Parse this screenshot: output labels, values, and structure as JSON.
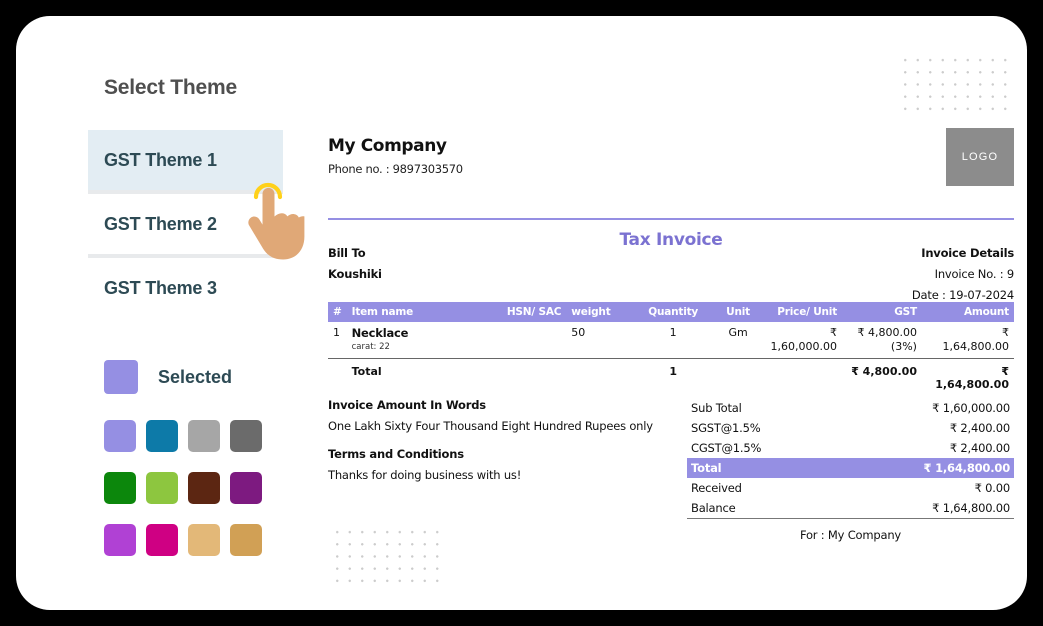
{
  "panel": {
    "title": "Select Theme",
    "themes": [
      {
        "label": "GST Theme 1",
        "active": true
      },
      {
        "label": "GST Theme 2",
        "active": false
      },
      {
        "label": "GST Theme 3",
        "active": false
      }
    ],
    "selected_label": "Selected",
    "selected_color": "#958fe3",
    "palette": [
      {
        "name": "periwinkle",
        "hex": "#958fe3"
      },
      {
        "name": "teal-blue",
        "hex": "#0d7aa8"
      },
      {
        "name": "light-gray",
        "hex": "#a6a6a6"
      },
      {
        "name": "dark-gray",
        "hex": "#6b6b6b"
      },
      {
        "name": "green",
        "hex": "#0c870c"
      },
      {
        "name": "lime-green",
        "hex": "#8dc63f"
      },
      {
        "name": "dark-brown",
        "hex": "#5c2612"
      },
      {
        "name": "purple",
        "hex": "#7d1a80"
      },
      {
        "name": "orchid",
        "hex": "#b041d4"
      },
      {
        "name": "magenta",
        "hex": "#cf0083"
      },
      {
        "name": "light-tan",
        "hex": "#e3b878"
      },
      {
        "name": "tan",
        "hex": "#d1a055"
      }
    ]
  },
  "invoice": {
    "company_name": "My Company",
    "company_phone": "Phone no. : 9897303570",
    "logo_text": "LOGO",
    "title": "Tax Invoice",
    "accent_color": "#958fe3",
    "bill_to": {
      "label": "Bill To",
      "name": "Koushiki"
    },
    "details": {
      "label": "Invoice Details",
      "invoice_no": "Invoice No. : 9",
      "date": "Date : 19-07-2024"
    },
    "table": {
      "headers": [
        "#",
        "Item name",
        "HSN/ SAC",
        "weight",
        "Quantity",
        "Unit",
        "Price/ Unit",
        "GST",
        "Amount"
      ],
      "rows": [
        {
          "sno": "1",
          "item_name": "Necklace",
          "item_sub": "carat: 22",
          "hsn": "",
          "weight": "50",
          "quantity": "1",
          "unit": "Gm",
          "price_line1": "₹",
          "price_line2": "1,60,000.00",
          "gst_line1": "₹ 4,800.00",
          "gst_line2": "(3%)",
          "amount_line1": "₹",
          "amount_line2": "1,64,800.00"
        }
      ],
      "total": {
        "label": "Total",
        "quantity": "1",
        "gst": "₹ 4,800.00",
        "amount_line1": "₹",
        "amount_line2": "1,64,800.00"
      }
    },
    "words": {
      "heading": "Invoice Amount In Words",
      "text": "One Lakh Sixty Four Thousand Eight Hundred Rupees only"
    },
    "terms": {
      "heading": "Terms and Conditions",
      "text": "Thanks for doing business with us!"
    },
    "summary": [
      {
        "label": "Sub Total",
        "amount": "₹ 1,60,000.00",
        "highlight": false
      },
      {
        "label": "SGST@1.5%",
        "amount": "₹ 2,400.00",
        "highlight": false
      },
      {
        "label": "CGST@1.5%",
        "amount": "₹ 2,400.00",
        "highlight": false
      },
      {
        "label": "Total",
        "amount": "₹ 1,64,800.00",
        "highlight": true
      },
      {
        "label": "Received",
        "amount": "₹ 0.00",
        "highlight": false
      },
      {
        "label": "Balance",
        "amount": "₹ 1,64,800.00",
        "highlight": false
      }
    ],
    "signature": "For : My Company"
  },
  "cursor": {
    "icon": "tap-hand-icon",
    "skin_color": "#e0a877",
    "ring_color": "#ffd11a"
  }
}
